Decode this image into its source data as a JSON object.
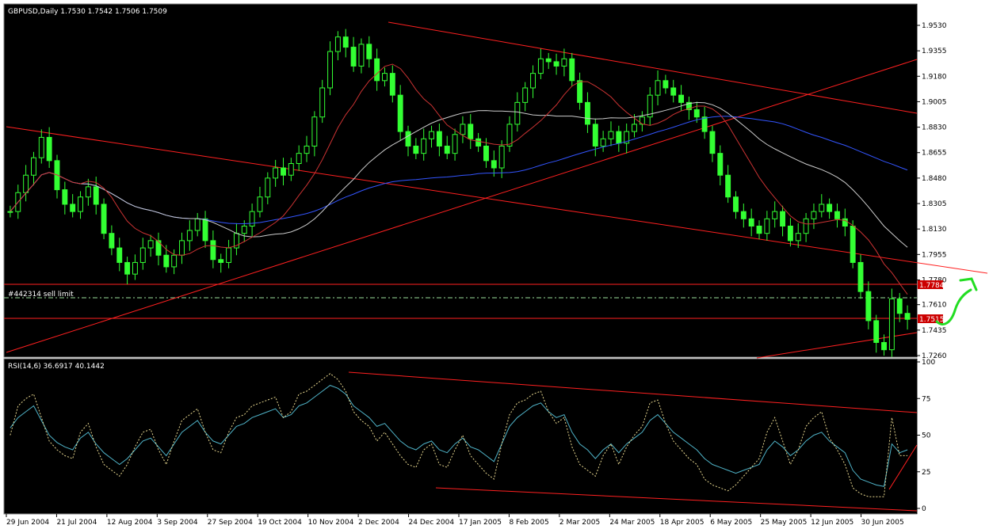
{
  "chart_data": [
    {
      "type": "candlestick",
      "title": "GBPUSD,Daily  1.7530 1.7542 1.7506 1.7509",
      "symbol": "GBPUSD",
      "timeframe": "Daily",
      "ohlc_last": [
        1.753,
        1.7542,
        1.7506,
        1.7509
      ],
      "ylim": [
        1.726,
        1.953
      ],
      "y_ticks": [
        "1.9530",
        "1.9355",
        "1.9180",
        "1.9005",
        "1.8830",
        "1.8655",
        "1.8480",
        "1.8305",
        "1.8130",
        "1.7955",
        "1.7780",
        "1.7610",
        "1.7435",
        "1.7260"
      ],
      "x_ticks": [
        "29 Jun 2004",
        "21 Jul 2004",
        "12 Aug 2004",
        "3 Sep 2004",
        "27 Sep 2004",
        "19 Oct 2004",
        "10 Nov 2004",
        "2 Dec 2004",
        "24 Dec 2004",
        "17 Jan 2005",
        "8 Feb 2005",
        "2 Mar 2005",
        "24 Mar 2005",
        "18 Apr 2005",
        "6 May 2005",
        "25 May 2005",
        "12 Jun 2005",
        "30 Jun 2005"
      ],
      "order_label": "#442314 sell limit",
      "price_tags": [
        "1.7784",
        "1.7515"
      ],
      "close_series": [
        1.825,
        1.838,
        1.85,
        1.862,
        1.876,
        1.86,
        1.84,
        1.83,
        1.825,
        1.835,
        1.842,
        1.83,
        1.81,
        1.8,
        1.79,
        1.782,
        1.79,
        1.8,
        1.805,
        1.795,
        1.787,
        1.795,
        1.805,
        1.812,
        1.82,
        1.805,
        1.792,
        1.79,
        1.8,
        1.81,
        1.815,
        1.825,
        1.835,
        1.848,
        1.855,
        1.85,
        1.858,
        1.865,
        1.87,
        1.89,
        1.91,
        1.935,
        1.945,
        1.938,
        1.925,
        1.94,
        1.93,
        1.915,
        1.92,
        1.905,
        1.88,
        1.87,
        1.865,
        1.875,
        1.88,
        1.87,
        1.865,
        1.878,
        1.885,
        1.875,
        1.87,
        1.86,
        1.855,
        1.87,
        1.885,
        1.9,
        1.91,
        1.92,
        1.93,
        1.928,
        1.925,
        1.93,
        1.915,
        1.9,
        1.885,
        1.87,
        1.875,
        1.88,
        1.872,
        1.88,
        1.885,
        1.89,
        1.905,
        1.915,
        1.91,
        1.905,
        1.9,
        1.895,
        1.89,
        1.88,
        1.865,
        1.85,
        1.835,
        1.825,
        1.82,
        1.815,
        1.81,
        1.82,
        1.825,
        1.815,
        1.805,
        1.81,
        1.82,
        1.825,
        1.83,
        1.825,
        1.82,
        1.815,
        1.79,
        1.77,
        1.75,
        1.735,
        1.73,
        1.765,
        1.755,
        1.7509
      ]
    },
    {
      "type": "line",
      "title": "RSI(14,6)  36.6917  40.1442",
      "ylim": [
        0,
        100
      ],
      "y_ticks": [
        "100",
        "75",
        "50",
        "25",
        "0"
      ],
      "series": [
        {
          "name": "RSI(14,6)",
          "values": [
            55,
            62,
            66,
            70,
            60,
            50,
            45,
            42,
            40,
            48,
            52,
            44,
            38,
            34,
            30,
            34,
            40,
            46,
            48,
            42,
            36,
            44,
            52,
            56,
            60,
            52,
            46,
            44,
            50,
            56,
            58,
            62,
            64,
            66,
            68,
            62,
            64,
            70,
            72,
            76,
            80,
            84,
            82,
            78,
            70,
            66,
            62,
            56,
            58,
            52,
            46,
            42,
            40,
            44,
            46,
            40,
            38,
            44,
            48,
            42,
            40,
            36,
            32,
            44,
            56,
            62,
            66,
            70,
            72,
            66,
            62,
            64,
            52,
            44,
            40,
            34,
            40,
            44,
            38,
            44,
            48,
            52,
            60,
            64,
            58,
            52,
            48,
            44,
            40,
            34,
            30,
            28,
            26,
            24,
            26,
            28,
            30,
            40,
            46,
            42,
            36,
            40,
            46,
            50,
            52,
            46,
            42,
            38,
            26,
            20,
            18,
            16,
            15,
            44,
            38,
            40
          ]
        },
        {
          "name": "",
          "values": [
            50,
            70,
            75,
            78,
            62,
            46,
            40,
            36,
            34,
            52,
            58,
            42,
            30,
            26,
            22,
            30,
            42,
            52,
            54,
            40,
            30,
            46,
            60,
            64,
            68,
            52,
            40,
            38,
            52,
            62,
            64,
            70,
            72,
            74,
            76,
            62,
            66,
            78,
            80,
            84,
            88,
            92,
            88,
            80,
            66,
            60,
            56,
            46,
            52,
            44,
            36,
            30,
            28,
            40,
            44,
            30,
            28,
            40,
            50,
            36,
            30,
            24,
            20,
            44,
            64,
            72,
            74,
            78,
            80,
            66,
            58,
            62,
            42,
            30,
            26,
            22,
            36,
            44,
            30,
            42,
            50,
            56,
            72,
            74,
            58,
            46,
            40,
            34,
            30,
            20,
            16,
            14,
            12,
            16,
            22,
            28,
            34,
            52,
            62,
            46,
            30,
            40,
            56,
            62,
            66,
            48,
            40,
            30,
            14,
            10,
            8,
            8,
            8,
            62,
            36,
            36
          ]
        }
      ]
    }
  ]
}
